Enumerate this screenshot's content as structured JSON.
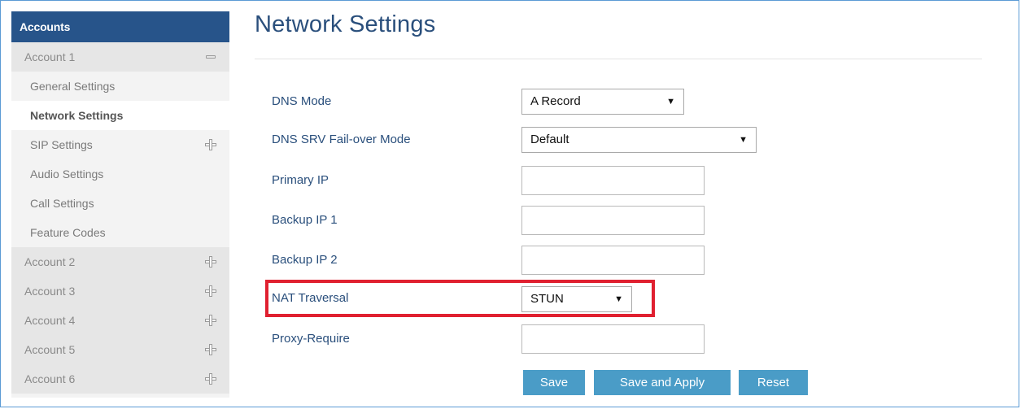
{
  "sidebar": {
    "header": "Accounts",
    "rows": [
      {
        "label": "Account 1",
        "type": "account",
        "toggle": "minus"
      },
      {
        "label": "General Settings",
        "type": "sub"
      },
      {
        "label": "Network Settings",
        "type": "sub",
        "active": true
      },
      {
        "label": "SIP Settings",
        "type": "sub",
        "toggle": "plus"
      },
      {
        "label": "Audio Settings",
        "type": "sub"
      },
      {
        "label": "Call Settings",
        "type": "sub"
      },
      {
        "label": "Feature Codes",
        "type": "sub"
      },
      {
        "label": "Account 2",
        "type": "account",
        "toggle": "plus"
      },
      {
        "label": "Account 3",
        "type": "account",
        "toggle": "plus"
      },
      {
        "label": "Account 4",
        "type": "account",
        "toggle": "plus"
      },
      {
        "label": "Account 5",
        "type": "account",
        "toggle": "plus"
      },
      {
        "label": "Account 6",
        "type": "account",
        "toggle": "plus"
      }
    ]
  },
  "main": {
    "title": "Network Settings",
    "fields": {
      "dns_mode": {
        "label": "DNS Mode",
        "value": "A Record"
      },
      "dns_srv_failover": {
        "label": "DNS SRV Fail-over Mode",
        "value": "Default"
      },
      "primary_ip": {
        "label": "Primary IP",
        "value": ""
      },
      "backup_ip_1": {
        "label": "Backup IP 1",
        "value": ""
      },
      "backup_ip_2": {
        "label": "Backup IP 2",
        "value": ""
      },
      "nat_traversal": {
        "label": "NAT Traversal",
        "value": "STUN"
      },
      "proxy_require": {
        "label": "Proxy-Require",
        "value": ""
      }
    },
    "buttons": {
      "save": "Save",
      "save_apply": "Save and Apply",
      "reset": "Reset"
    }
  },
  "colors": {
    "sidebar_header": "#27548a",
    "title_text": "#2a4f7c",
    "button": "#4a9cc7",
    "highlight": "#e02030",
    "frame_border": "#5b9bd5"
  },
  "icons": {
    "expanded": "minus-icon",
    "collapsed": "plus-icon",
    "dropdown": "dropdown-arrow-icon"
  }
}
